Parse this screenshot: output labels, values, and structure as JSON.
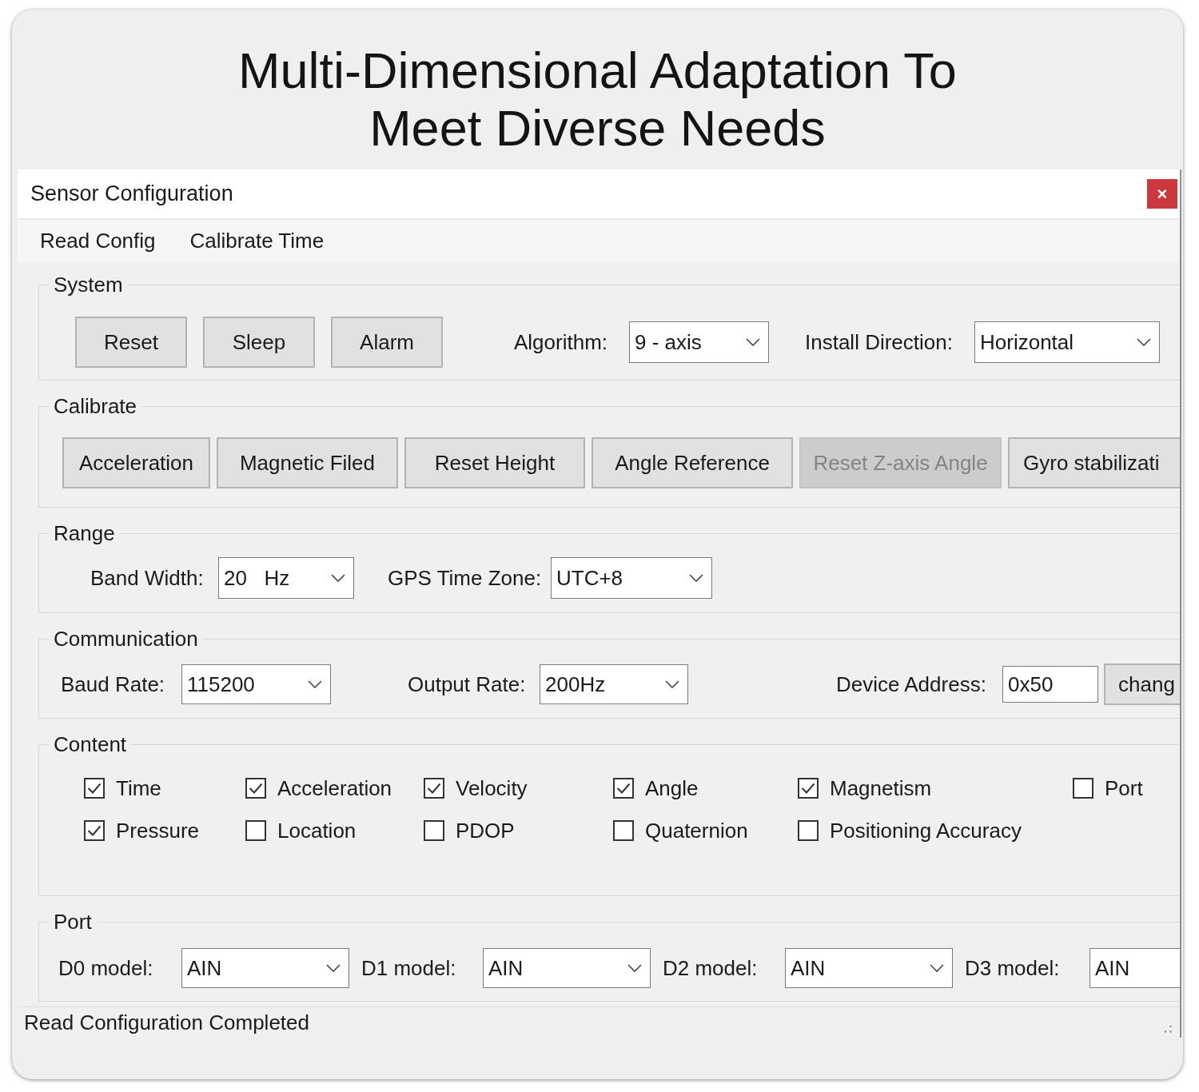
{
  "heading": [
    "Multi-Dimensional Adaptation To",
    "Meet Diverse Needs"
  ],
  "window": {
    "title": "Sensor Configuration",
    "close_button": "×"
  },
  "menu": [
    "Read Config",
    "Calibrate Time"
  ],
  "system": {
    "legend": "System",
    "buttons": [
      "Reset",
      "Sleep",
      "Alarm"
    ],
    "fields": [
      {
        "label": "Algorithm:",
        "value": "9 - axis"
      },
      {
        "label": "Install Direction:",
        "value": "Horizontal"
      }
    ]
  },
  "calibrate": {
    "legend": "Calibrate",
    "buttons": [
      {
        "label": "Acceleration",
        "disabled": false
      },
      {
        "label": "Magnetic Filed",
        "disabled": false
      },
      {
        "label": "Reset Height",
        "disabled": false
      },
      {
        "label": "Angle Reference",
        "disabled": false
      },
      {
        "label": "Reset Z-axis Angle",
        "disabled": true
      },
      {
        "label": "Gyro stabilizati",
        "disabled": false
      }
    ]
  },
  "range": {
    "legend": "Range",
    "fields": [
      {
        "label": "Band Width:",
        "value": "20   Hz"
      },
      {
        "label": "GPS Time Zone:",
        "value": "UTC+8"
      }
    ]
  },
  "communication": {
    "legend": "Communication",
    "fields": [
      {
        "kind": "select",
        "label": "Baud Rate:",
        "value": "115200"
      },
      {
        "kind": "select",
        "label": "Output Rate:",
        "value": "200Hz"
      },
      {
        "kind": "input",
        "label": "Device Address:",
        "value": "0x50"
      }
    ],
    "button": "chang"
  },
  "content": {
    "legend": "Content",
    "options": [
      {
        "label": "Time",
        "checked": true
      },
      {
        "label": "Acceleration",
        "checked": true
      },
      {
        "label": "Velocity",
        "checked": true
      },
      {
        "label": "Angle",
        "checked": true
      },
      {
        "label": "Magnetism",
        "checked": true
      },
      {
        "label": "Port",
        "checked": false
      },
      {
        "label": "Pressure",
        "checked": true
      },
      {
        "label": "Location",
        "checked": false
      },
      {
        "label": "PDOP",
        "checked": false
      },
      {
        "label": "Quaternion",
        "checked": false
      },
      {
        "label": "Positioning Accuracy",
        "checked": false
      }
    ]
  },
  "port": {
    "legend": "Port",
    "fields": [
      {
        "label": "D0 model:",
        "value": "AIN"
      },
      {
        "label": "D1 model:",
        "value": "AIN"
      },
      {
        "label": "D2 model:",
        "value": "AIN"
      },
      {
        "label": "D3 model:",
        "value": "AIN"
      }
    ]
  },
  "status_bar": {
    "text": "Read Configuration Completed"
  }
}
